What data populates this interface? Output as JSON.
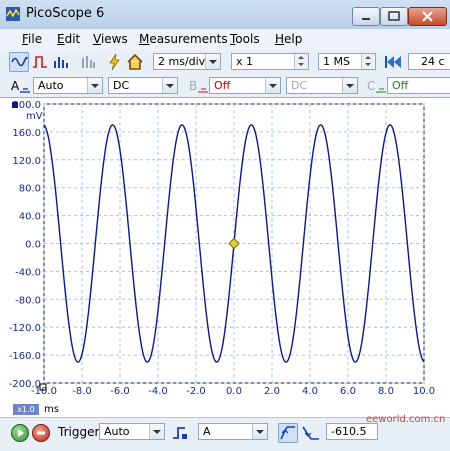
{
  "window": {
    "title": "PicoScope 6"
  },
  "menu": [
    {
      "label": "File",
      "key": "F",
      "rest": "ile"
    },
    {
      "label": "Edit",
      "key": "E",
      "rest": "dit"
    },
    {
      "label": "Views",
      "key": "V",
      "rest": "iews"
    },
    {
      "label": "Measurements",
      "key": "M",
      "rest": "easurements"
    },
    {
      "label": "Tools",
      "key": "T",
      "rest": "ools"
    },
    {
      "label": "Help",
      "key": "H",
      "rest": "elp"
    }
  ],
  "toolbar": {
    "timebase": "2 ms/div",
    "zoom": "x 1",
    "samples": "1 MS",
    "buffer": "24 c"
  },
  "channels": {
    "a": {
      "label": "A",
      "range": "Auto",
      "coupling": "DC"
    },
    "b": {
      "label": "B",
      "state": "Off",
      "coupling": "DC"
    },
    "c": {
      "label": "C",
      "state": "Off"
    }
  },
  "scope": {
    "y_unit": "mV",
    "x_unit": "ms",
    "zoom_badge": "x1.0",
    "trigger_marker_color": "#e0d040",
    "trace_color": "#0a1a80"
  },
  "chart_data": {
    "type": "line",
    "xlabel": "ms",
    "ylabel": "mV",
    "xlim": [
      -10.0,
      10.0
    ],
    "ylim": [
      -200.0,
      200.0
    ],
    "x_ticks": [
      "-10.0",
      "-8.0",
      "-6.0",
      "-4.0",
      "-2.0",
      "0.0",
      "2.0",
      "4.0",
      "6.0",
      "8.0",
      "10.0"
    ],
    "y_ticks": [
      "200.0",
      "160.0",
      "120.0",
      "80.0",
      "40.0",
      "0.0",
      "-40.0",
      "-80.0",
      "-120.0",
      "-160.0",
      "-200.0"
    ],
    "grid": true,
    "series": [
      {
        "amplitude_mv": 170,
        "period_ms": 3.65,
        "phase_zero_ms": 0.0
      }
    ]
  },
  "bottom": {
    "trigger_label": "Trigger",
    "trigger_mode": "Auto",
    "trigger_source": "A",
    "trigger_level": "-610.5"
  },
  "watermark": "eeworld.com.cn"
}
